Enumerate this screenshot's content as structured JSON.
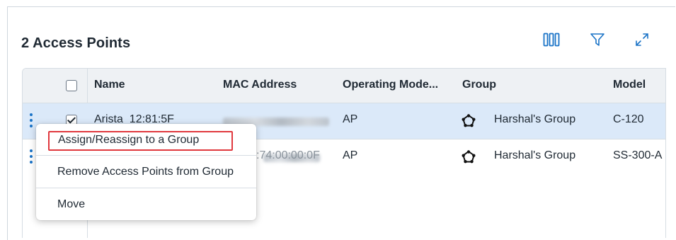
{
  "header": {
    "title": "2 Access Points",
    "icons": [
      "columns-icon",
      "filter-icon",
      "expand-icon"
    ]
  },
  "table": {
    "columns": [
      "",
      "Name",
      "MAC Address",
      "Operating Mode...",
      "Group",
      "Model"
    ],
    "rows": [
      {
        "selected": true,
        "checked": true,
        "name": "Arista_12:81:5F",
        "mac_address_visible": "",
        "operating_mode": "AP",
        "group": "Harshal's Group",
        "model": "C-120"
      },
      {
        "selected": false,
        "checked": false,
        "name": "",
        "mac_address_visible": ":74:00:00:0F",
        "operating_mode": "AP",
        "group": "Harshal's Group",
        "model": "SS-300-A"
      }
    ]
  },
  "context_menu": {
    "items": [
      {
        "label": "Assign/Reassign to a Group",
        "highlighted": true
      },
      {
        "label": "Remove Access Points from Group",
        "highlighted": false
      },
      {
        "label": "Move",
        "highlighted": false
      }
    ]
  },
  "colors": {
    "accent": "#1a73c7",
    "selected_row": "#dbe9f9",
    "header_bg": "#eef1f4",
    "highlight_border": "#e0383e"
  }
}
